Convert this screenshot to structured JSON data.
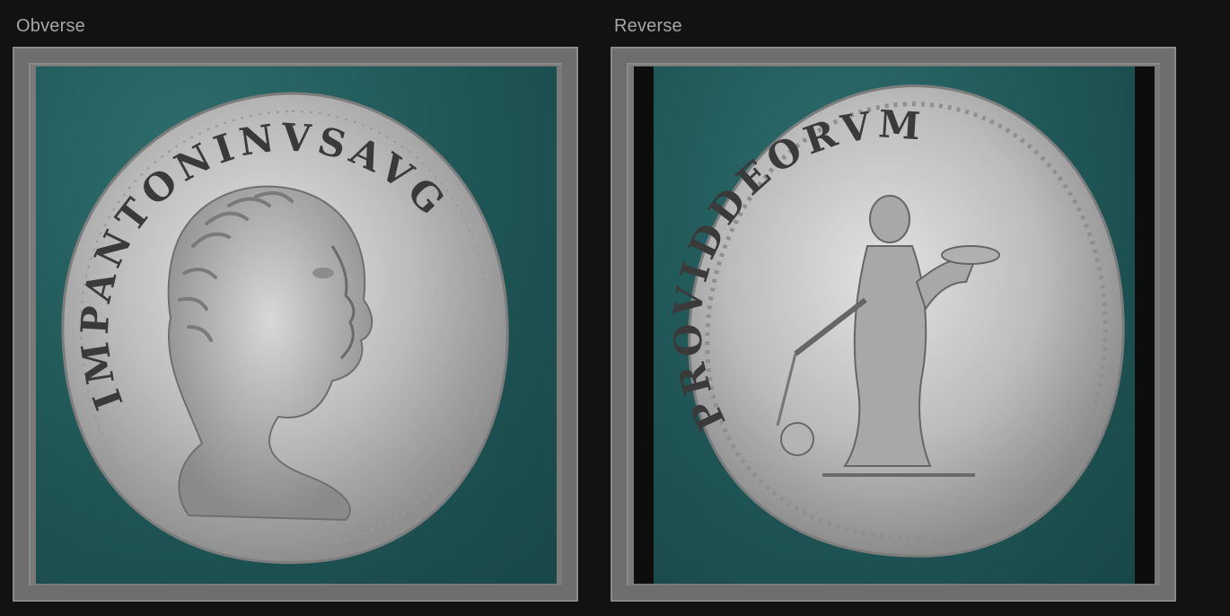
{
  "panels": {
    "obverse": {
      "label": "Obverse"
    },
    "reverse": {
      "label": "Reverse"
    }
  },
  "colors": {
    "background": "#121212",
    "frame": "#6e6e6e",
    "felt": "#1f5555",
    "coin_silver": "#c9c9c9",
    "caption": "#a6a6a6"
  }
}
